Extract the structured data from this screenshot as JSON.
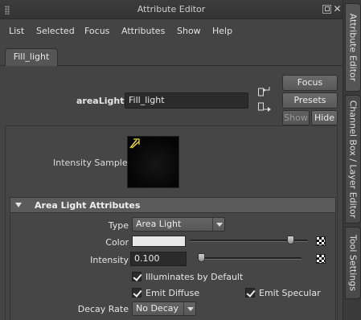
{
  "window": {
    "title": "Attribute Editor",
    "float_icon": "float-window-icon",
    "close_icon": "close-icon"
  },
  "menu": [
    "List",
    "Selected",
    "Focus",
    "Attributes",
    "Show",
    "Help"
  ],
  "tab": {
    "label": "Fill_light"
  },
  "node": {
    "type_label": "areaLight:",
    "name": "Fill_light"
  },
  "buttons": {
    "focus": "Focus",
    "presets": "Presets",
    "show": "Show",
    "hide": "Hide"
  },
  "sample": {
    "label": "Intensity Sample"
  },
  "section": {
    "title": "Area Light Attributes",
    "expanded": true
  },
  "attributes": {
    "type": {
      "label": "Type",
      "value": "Area Light"
    },
    "color": {
      "label": "Color",
      "value": "#e9e9e9",
      "slider_fraction": 0.88
    },
    "intensity": {
      "label": "Intensity",
      "value": "0.100",
      "slider_fraction": 0.01
    },
    "illuminates_by_default": {
      "label": "Illuminates by Default",
      "checked": true
    },
    "emit_diffuse": {
      "label": "Emit Diffuse",
      "checked": true
    },
    "emit_specular": {
      "label": "Emit Specular",
      "checked": true
    },
    "decay_rate": {
      "label": "Decay Rate",
      "value": "No Decay"
    }
  },
  "dock_tabs": [
    "Attribute Editor",
    "Channel Box / Layer Editor",
    "Tool Settings"
  ]
}
